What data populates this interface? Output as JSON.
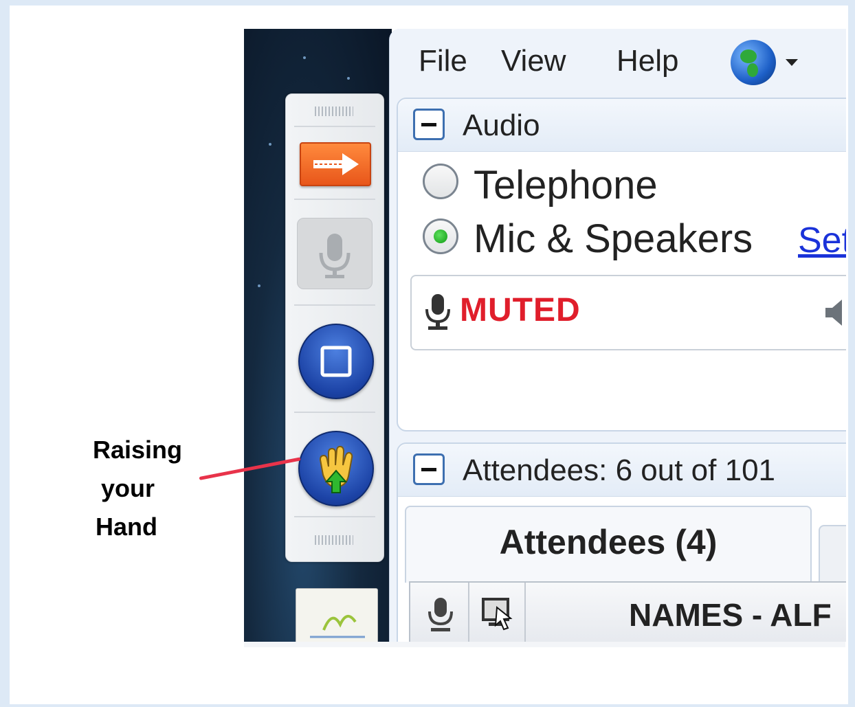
{
  "menu": {
    "file": "File",
    "view": "View",
    "help": "Help"
  },
  "audio_panel": {
    "title": "Audio",
    "options": [
      {
        "label": "Telephone",
        "selected": false
      },
      {
        "label": "Mic & Speakers",
        "selected": true
      }
    ],
    "setup_link": "Set",
    "status": "MUTED"
  },
  "attendees_panel": {
    "title": "Attendees:  6 out of 101",
    "tab_label": "Attendees (4)",
    "names_column": "NAMES - ALF"
  },
  "annotation": {
    "line1": "Raising",
    "line2": "your",
    "line3": "Hand"
  },
  "colors": {
    "muted": "#e01e2b",
    "link": "#1a32d9",
    "pointer": "#e8334a"
  }
}
